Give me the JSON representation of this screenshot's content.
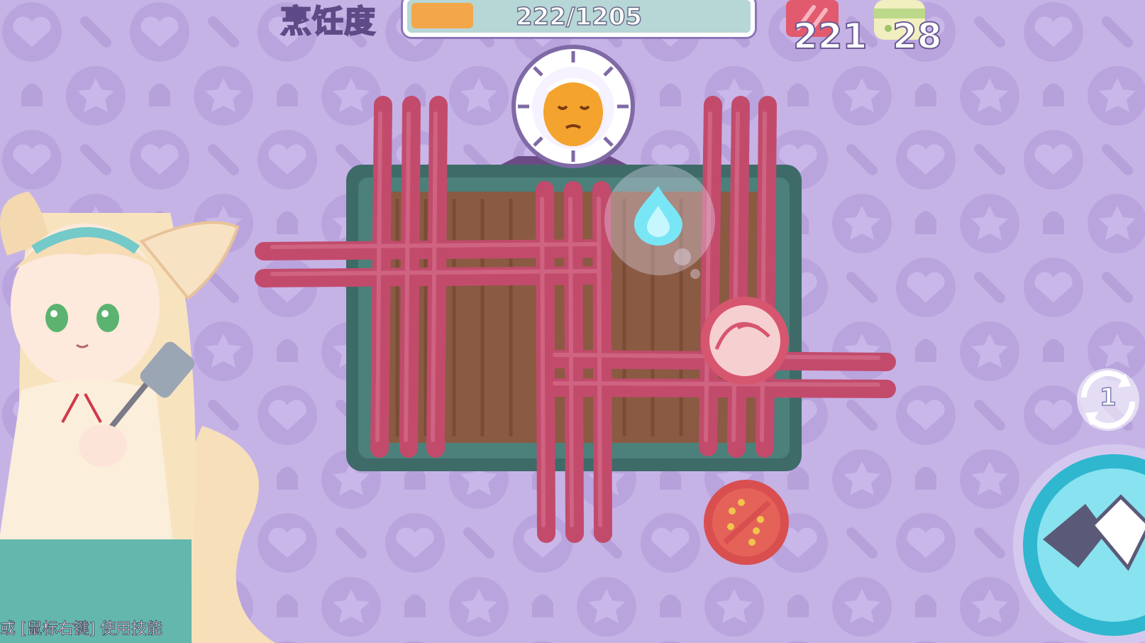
{
  "hud": {
    "progress_label": "烹饪度",
    "progress_text": "222/1205",
    "progress_fraction": 0.184,
    "meat_count": "221",
    "dumpling_count": "28"
  },
  "controls": {
    "reset_counter": "1"
  },
  "hint": {
    "text": "或 [鼠标右键] 使用技能"
  },
  "icons": {
    "meat_resource": "meat-icon",
    "dumpling_resource": "dumpling-icon",
    "fire": "blue-flame-icon",
    "reset": "reset-icon",
    "skill": "skill-icon"
  },
  "colors": {
    "background": "#c6b3e6",
    "sausage": "#c24b6c",
    "grill_frame": "#3e6b68",
    "grill_surface": "#8b5a43",
    "progress_fill": "#f4a64a",
    "flame": "#79e6f5"
  }
}
